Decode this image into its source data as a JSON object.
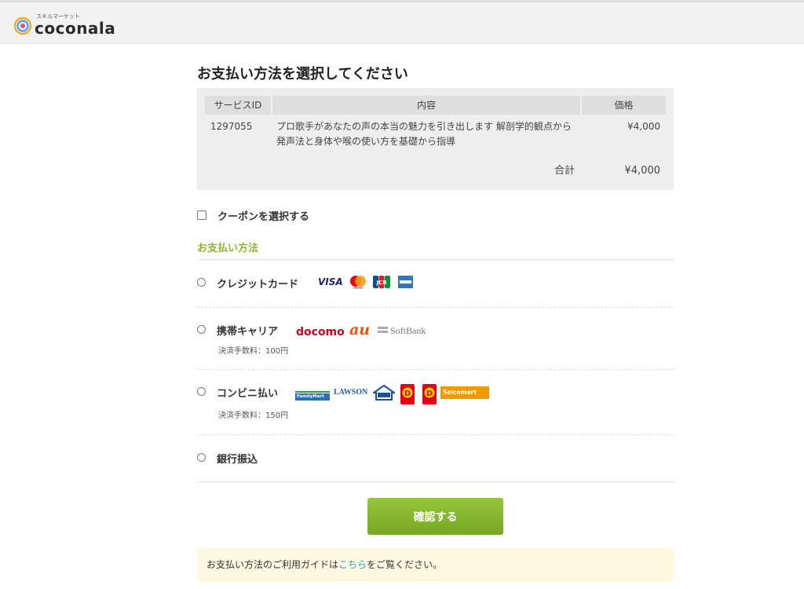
{
  "header": {
    "logo_sub": "スキルマーケット",
    "logo_text": "coconala"
  },
  "page_title": "お支払い方法を選択してください",
  "order_table": {
    "headers": [
      "サービスID",
      "内容",
      "価格"
    ],
    "row": {
      "service_id": "1297055",
      "description_line1": "プロ歌手があなたの声の本当の魅力を引き出します 解剖学的観点から",
      "description_line2": "発声法と身体や喉の使い方を基礎から指導",
      "price": "¥4,000"
    },
    "total_label": "合計",
    "total_value": "¥4,000"
  },
  "coupon": {
    "label": "クーポンを選択する"
  },
  "payment_section_title": "お支払い方法",
  "payment_methods": [
    {
      "label": "クレジットカード",
      "logos": [
        "VISA",
        "mastercard",
        "JCB",
        "AMEX"
      ]
    },
    {
      "label": "携帯キャリア",
      "fee": "決済手数料：100円",
      "logos": [
        "docomo",
        "au",
        "SoftBank"
      ]
    },
    {
      "label": "コンビニ払い",
      "fee": "決済手数料：150円",
      "logos": [
        "FamilyMart",
        "LAWSON",
        "MINISTOP",
        "Daily Yamazaki",
        "Daily",
        "Seicomart"
      ]
    },
    {
      "label": "銀行振込"
    }
  ],
  "confirm_button": "確認する",
  "guide": {
    "prefix": "お支払い方法のご利用ガイドは",
    "link": "こちら",
    "suffix": "をご覧ください。"
  },
  "colors": {
    "accent_green": "#8ab828",
    "button_green": "#84b82f",
    "link_blue": "#2a9ad8",
    "guide_bg": "#fdf8df"
  }
}
